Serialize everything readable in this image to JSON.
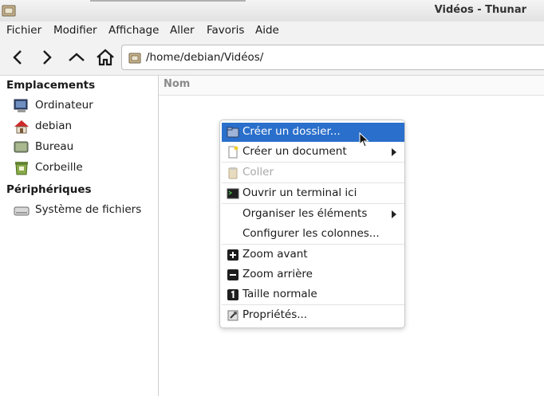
{
  "window": {
    "title": "Vidéos - Thunar",
    "icon": "folder-icon"
  },
  "menubar": [
    "Fichier",
    "Modifier",
    "Affichage",
    "Aller",
    "Favoris",
    "Aide"
  ],
  "toolbar": {
    "back_icon": "chevron-left-icon",
    "forward_icon": "chevron-right-icon",
    "up_icon": "chevron-up-icon",
    "home_icon": "home-icon"
  },
  "address": {
    "path": "/home/debian/Vidéos/"
  },
  "sidebar": {
    "places_heading": "Emplacements",
    "places": [
      {
        "label": "Ordinateur",
        "icon": "computer-icon"
      },
      {
        "label": "debian",
        "icon": "home-icon"
      },
      {
        "label": "Bureau",
        "icon": "desktop-icon"
      },
      {
        "label": "Corbeille",
        "icon": "trash-icon"
      }
    ],
    "devices_heading": "Périphériques",
    "devices": [
      {
        "label": "Système de fichiers",
        "icon": "drive-icon"
      }
    ]
  },
  "main": {
    "column_name": "Nom"
  },
  "context_menu": {
    "items": [
      {
        "label": "Créer un dossier...",
        "icon": "new-folder-icon",
        "active": true
      },
      {
        "label": "Créer un document",
        "icon": "new-document-icon",
        "submenu": true
      },
      {
        "label": "Coller",
        "icon": "paste-icon",
        "disabled": true
      },
      {
        "label": "Ouvrir un terminal ici",
        "icon": "terminal-icon"
      },
      {
        "label": "Organiser les éléments",
        "submenu": true
      },
      {
        "label": "Configurer les colonnes..."
      },
      {
        "label": "Zoom avant",
        "icon": "zoom-in-icon"
      },
      {
        "label": "Zoom arrière",
        "icon": "zoom-out-icon"
      },
      {
        "label": "Taille normale",
        "icon": "zoom-normal-icon"
      },
      {
        "label": "Propriétés...",
        "icon": "properties-icon"
      }
    ]
  },
  "colors": {
    "selection": "#2a6fcb",
    "folder": "#c9b48c"
  }
}
